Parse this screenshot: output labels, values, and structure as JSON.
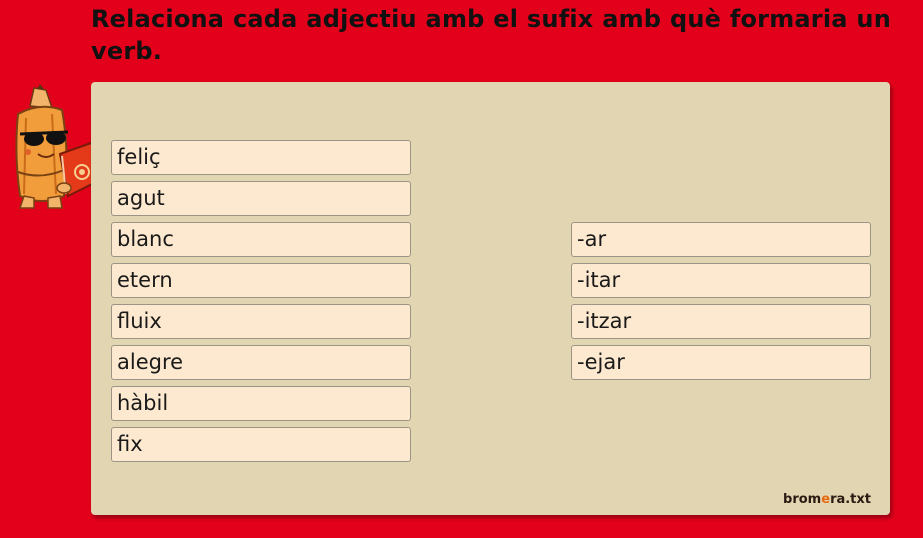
{
  "instruction": "Relaciona cada adjectiu amb el sufix amb què formaria un verb.",
  "adjectives": [
    "feliç",
    "agut",
    "blanc",
    "etern",
    "fluix",
    "alegre",
    "hàbil",
    "fix"
  ],
  "suffixes": [
    "-ar",
    "-itar",
    "-itzar",
    "-ejar"
  ],
  "brand": {
    "part1": "brom",
    "part2": "e",
    "part3": "ra.txt"
  },
  "colors": {
    "background": "#e3001b",
    "panel": "#e2d5b1",
    "card": "#fde9cf",
    "brand_accent": "#e76a10"
  },
  "mascot_icon": "pencil-mascot-reading-book"
}
